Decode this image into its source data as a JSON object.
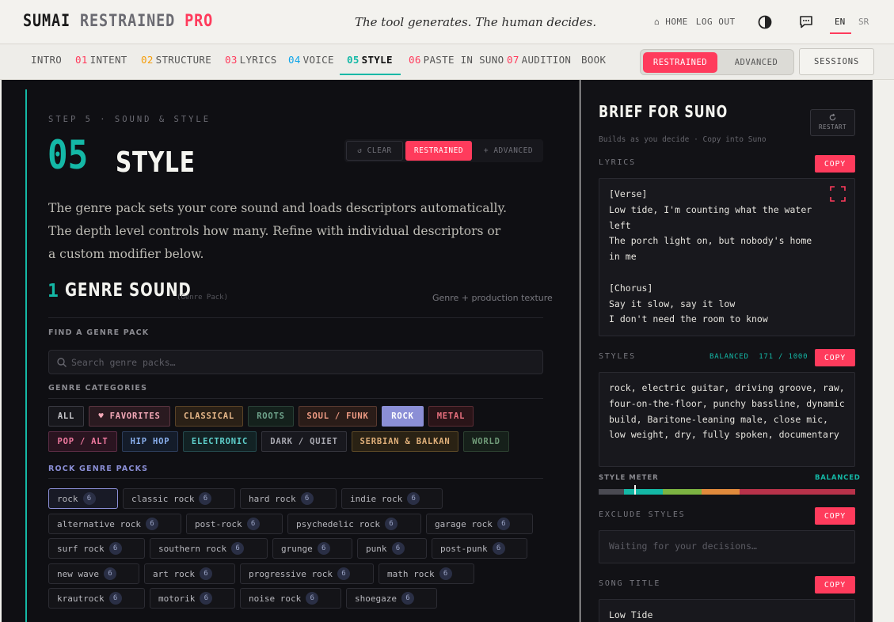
{
  "brand": {
    "part1": "SUMAI",
    "part2": "RESTRAINED",
    "part3": "PRO"
  },
  "tagline": "The tool generates. The human decides.",
  "top_links": {
    "home": "⌂ HOME",
    "logout": "LOG OUT"
  },
  "languages": {
    "en": "EN",
    "sr": "SR"
  },
  "nav": {
    "items": [
      {
        "num": "",
        "label": "INTRO",
        "num_color": ""
      },
      {
        "num": "01",
        "label": "INTENT",
        "num_color": "#ff3b5c"
      },
      {
        "num": "02",
        "label": "STRUCTURE",
        "num_color": "#f59e0b"
      },
      {
        "num": "03",
        "label": "LYRICS",
        "num_color": "#ff3b5c"
      },
      {
        "num": "04",
        "label": "VOICE",
        "num_color": "#0ea5e9"
      },
      {
        "num": "05",
        "label": "STYLE",
        "num_color": "#14b8a6"
      },
      {
        "num": "06",
        "label": "PASTE IN SUNO",
        "num_color": "#ff3b5c"
      },
      {
        "num": "07",
        "label": "AUDITION",
        "num_color": "#ff3b5c"
      },
      {
        "num": "",
        "label": "BOOK",
        "num_color": ""
      }
    ],
    "mode_on": "RESTRAINED",
    "mode_off": "ADVANCED",
    "sessions": "SESSIONS"
  },
  "step": {
    "eyebrow": "STEP 5 · SOUND & STYLE",
    "number": "05",
    "title": "STYLE",
    "clear": "↺ CLEAR",
    "restrained": "RESTRAINED",
    "advanced": "+ ADVANCED",
    "intro": "The genre pack sets your core sound and loads descriptors automatically. The depth level controls how many. Refine with individual descriptors or a custom modifier below."
  },
  "section": {
    "number": "1",
    "title": "GENRE SOUND",
    "subtitle": "(Genre Pack)",
    "right_note": "Genre + production texture",
    "find_label": "FIND A GENRE PACK",
    "search_placeholder": "Search genre packs…",
    "categories_label": "GENRE CATEGORIES",
    "packs_label": "ROCK GENRE PACKS"
  },
  "categories": [
    {
      "label": "ALL"
    },
    {
      "label": "♥ FAVORITES"
    },
    {
      "label": "CLASSICAL"
    },
    {
      "label": "ROOTS"
    },
    {
      "label": "SOUL / FUNK"
    },
    {
      "label": "ROCK"
    },
    {
      "label": "METAL"
    },
    {
      "label": "POP / ALT"
    },
    {
      "label": "HIP HOP"
    },
    {
      "label": "ELECTRONIC"
    },
    {
      "label": "DARK / QUIET"
    },
    {
      "label": "SERBIAN & BALKAN"
    },
    {
      "label": "WORLD"
    }
  ],
  "packs": [
    {
      "name": "rock",
      "count": "6"
    },
    {
      "name": "classic rock",
      "count": "6"
    },
    {
      "name": "hard rock",
      "count": "6"
    },
    {
      "name": "indie rock",
      "count": "6"
    },
    {
      "name": "alternative rock",
      "count": "6"
    },
    {
      "name": "post-rock",
      "count": "6"
    },
    {
      "name": "psychedelic rock",
      "count": "6"
    },
    {
      "name": "garage rock",
      "count": "6"
    },
    {
      "name": "surf rock",
      "count": "6"
    },
    {
      "name": "southern rock",
      "count": "6"
    },
    {
      "name": "grunge",
      "count": "6"
    },
    {
      "name": "punk",
      "count": "6"
    },
    {
      "name": "post-punk",
      "count": "6"
    },
    {
      "name": "new wave",
      "count": "6"
    },
    {
      "name": "art rock",
      "count": "6"
    },
    {
      "name": "progressive rock",
      "count": "6"
    },
    {
      "name": "math rock",
      "count": "6"
    },
    {
      "name": "krautrock",
      "count": "6"
    },
    {
      "name": "motorik",
      "count": "6"
    },
    {
      "name": "noise rock",
      "count": "6"
    },
    {
      "name": "shoegaze",
      "count": "6"
    }
  ],
  "brief": {
    "title": "BRIEF FOR SUNO",
    "subtitle": "Builds as you decide · Copy into Suno",
    "restart": "RESTART",
    "lyrics_label": "LYRICS",
    "copy": "COPY",
    "lyrics": "[Verse]\nLow tide, I'm counting what the water left\nThe porch light on, but nobody's home in me\n\n[Chorus]\nSay it slow, say it low\nI don't need the room to know",
    "styles_label": "STYLES",
    "styles_state": "BALANCED",
    "styles_count": "171 / 1000",
    "styles": "rock, electric guitar, driving groove, raw, four-on-the-floor, punchy bassline, dynamic build, Baritone-leaning male, close mic, low weight, dry, fully spoken, documentary",
    "meter_label": "STYLE METER",
    "meter_state": "BALANCED",
    "meter_value": 171,
    "meter_max": 1000,
    "exclude_label": "EXCLUDE STYLES",
    "exclude_placeholder": "Waiting for your decisions…",
    "title_label": "SONG TITLE",
    "song_title": "Low Tide"
  },
  "colors": {
    "accent": "#ff3b5c",
    "teal": "#14b8a6",
    "rock_purple": "#8b8fd6"
  }
}
